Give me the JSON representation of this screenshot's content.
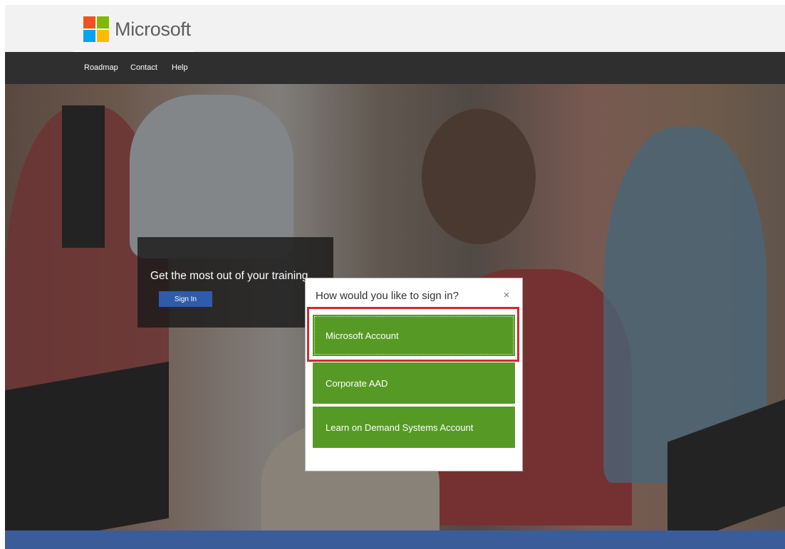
{
  "header": {
    "logo_text": "Microsoft"
  },
  "nav": {
    "items": [
      {
        "label": "Roadmap"
      },
      {
        "label": "Contact"
      },
      {
        "label": "Help"
      }
    ]
  },
  "promo": {
    "headline": "Get the most out of your training",
    "sign_in_label": "Sign In"
  },
  "dialog": {
    "title": "How would you like to sign in?",
    "close_glyph": "×",
    "options": [
      {
        "label": "Microsoft Account"
      },
      {
        "label": "Corporate AAD"
      },
      {
        "label": "Learn on Demand Systems Account"
      }
    ]
  },
  "colors": {
    "nav_bg": "#2f2f2f",
    "option_green": "#569a25",
    "sign_in_blue": "#2e5ca8",
    "highlight_red": "#d7282f",
    "bottom_band": "#3a5d99"
  }
}
